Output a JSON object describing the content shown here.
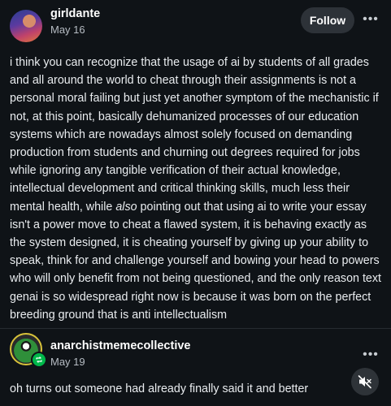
{
  "post1": {
    "username": "girldante",
    "date": "May 16",
    "follow_label": "Follow",
    "more_label": "•••",
    "body_part1": "i think you can recognize that the usage of ai by students of all grades and all around the world to cheat through their assignments is not a personal moral failing but just yet another symptom of the mechanistic if not, at this point, basically dehumanized processes of our education systems which are nowadays almost solely focused on demanding production from students and churning out degrees required for jobs while ignoring any tangible verification of their actual knowledge, intellectual development and critical thinking skills, much less their mental health, while ",
    "body_emphasis": "also",
    "body_part2": " pointing out that using ai to write your essay isn't a power move to cheat a flawed system, it is behaving exactly as the system designed, it is cheating yourself by giving up your ability to speak, think for and challenge yourself and bowing your head to powers who will only benefit from not being questioned, and the only reason text genai is so widespread right now is because it was born on the perfect breeding ground that is anti intellectualism"
  },
  "post2": {
    "username": "anarchistmemecollective",
    "date": "May 19",
    "more_label": "•••",
    "body": "oh turns out someone had already finally said it and better"
  },
  "icons": {
    "reblog_badge": "reblog-icon",
    "mute": "speaker-muted-icon"
  },
  "colors": {
    "background": "#0f1317",
    "follow_button": "#2d3238",
    "badge": "#00b84a"
  }
}
